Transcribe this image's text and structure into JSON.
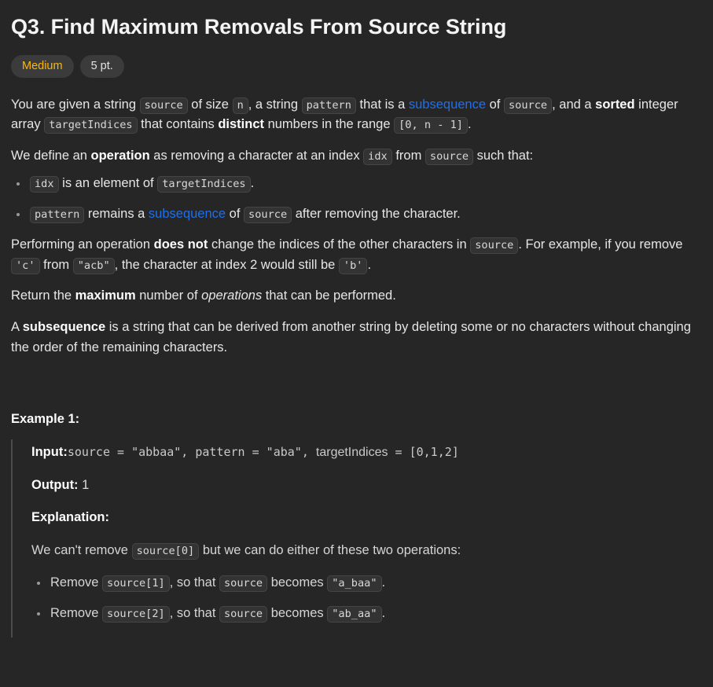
{
  "problem": {
    "title": "Q3. Find Maximum Removals From Source String",
    "badges": {
      "difficulty": "Medium",
      "points": "5 pt."
    },
    "statement": {
      "p1": {
        "t1": "You are given a string ",
        "c1": "source",
        "t2": " of size ",
        "c2": "n",
        "t3": ", a string ",
        "c3": "pattern",
        "t4": " that is a ",
        "link1": "subsequence",
        "t5": " of ",
        "c4": "source",
        "t6": ", and a ",
        "b1": "sorted",
        "t7": " integer array ",
        "c5": "targetIndices",
        "t8": " that contains ",
        "b2": "distinct",
        "t9": " numbers in the range ",
        "c6": "[0, n - 1]",
        "t10": "."
      },
      "p2": {
        "t1": "We define an ",
        "b1": "operation",
        "t2": " as removing a character at an index ",
        "c1": "idx",
        "t3": " from ",
        "c2": "source",
        "t4": " such that:"
      },
      "conditions": [
        {
          "c1": "idx",
          "t1": " is an element of ",
          "c2": "targetIndices",
          "t2": "."
        },
        {
          "c1": "pattern",
          "t1": " remains a ",
          "link1": "subsequence",
          "t2": " of ",
          "c2": "source",
          "t3": " after removing the character."
        }
      ],
      "p3": {
        "t1": "Performing an operation ",
        "b1": "does not",
        "t2": " change the indices of the other characters in ",
        "c1": "source",
        "t3": ". For example, if you remove ",
        "c2": "'c'",
        "t4": " from ",
        "c3": "\"acb\"",
        "t5": ", the character at index 2 would still be ",
        "c4": "'b'",
        "t6": "."
      },
      "p4": {
        "t1": "Return the ",
        "b1": "maximum",
        "t2": " number of ",
        "i1": "operations",
        "t3": " that can be performed."
      },
      "p5": {
        "t1": "A ",
        "b1": "subsequence",
        "t2": " is a string that can be derived from another string by deleting some or no characters without changing the order of the remaining characters."
      }
    },
    "example": {
      "heading": "Example 1:",
      "input_label": "Input:",
      "input_mono_1": "source = \"abbaa\", pattern = \"aba\", ",
      "input_sans": "targetIndices",
      "input_mono_2": " = [0,1,2]",
      "output_label": "Output:",
      "output_value": "1",
      "explanation_label": "Explanation:",
      "explanation_intro": {
        "t1": "We can't remove ",
        "c1": "source[0]",
        "t2": " but we can do either of these two operations:"
      },
      "operations": [
        {
          "t1": "Remove ",
          "c1": "source[1]",
          "t2": ", so that ",
          "c2": "source",
          "t3": " becomes ",
          "c3": "\"a_baa\"",
          "t4": "."
        },
        {
          "t1": "Remove ",
          "c1": "source[2]",
          "t2": ", so that ",
          "c2": "source",
          "t3": " becomes ",
          "c3": "\"ab_aa\"",
          "t4": "."
        }
      ]
    }
  },
  "colors": {
    "background": "#262626",
    "text": "#e6e6e6",
    "difficulty_medium": "#ffb700",
    "link": "#1f6feb",
    "chip_bg": "#333333",
    "badge_bg": "#3b3b3b",
    "quote_border": "#4a4a4a"
  }
}
